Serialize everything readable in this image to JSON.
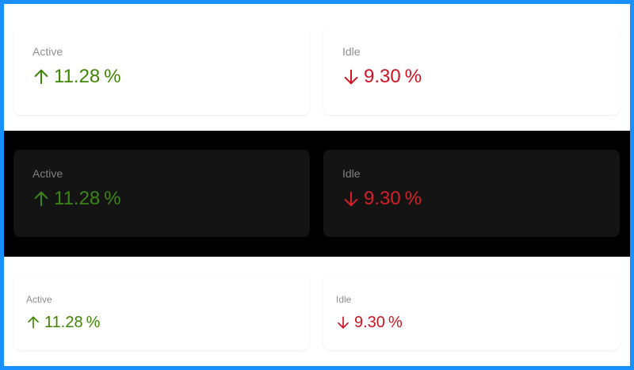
{
  "rows": [
    {
      "theme": "light",
      "cards": [
        {
          "title": "Active",
          "value": "11.28",
          "suffix": "%",
          "trend": "up",
          "icon": "arrow-up-icon",
          "color": "#3f8600"
        },
        {
          "title": "Idle",
          "value": "9.30",
          "suffix": "%",
          "trend": "down",
          "icon": "arrow-down-icon",
          "color": "#cf1322"
        }
      ]
    },
    {
      "theme": "dark",
      "cards": [
        {
          "title": "Active",
          "value": "11.28",
          "suffix": "%",
          "trend": "up",
          "icon": "arrow-up-icon",
          "color": "#3c8618"
        },
        {
          "title": "Idle",
          "value": "9.30",
          "suffix": "%",
          "trend": "down",
          "icon": "arrow-down-icon",
          "color": "#d32029"
        }
      ]
    },
    {
      "theme": "light-small",
      "cards": [
        {
          "title": "Active",
          "value": "11.28",
          "suffix": "%",
          "trend": "up",
          "icon": "arrow-up-icon",
          "color": "#3f8600"
        },
        {
          "title": "Idle",
          "value": "9.30",
          "suffix": "%",
          "trend": "down",
          "icon": "arrow-down-icon",
          "color": "#cf1322"
        }
      ]
    }
  ],
  "colors": {
    "frame_border": "#1890ff",
    "dark_background": "#000000",
    "dark_card": "#141414"
  }
}
